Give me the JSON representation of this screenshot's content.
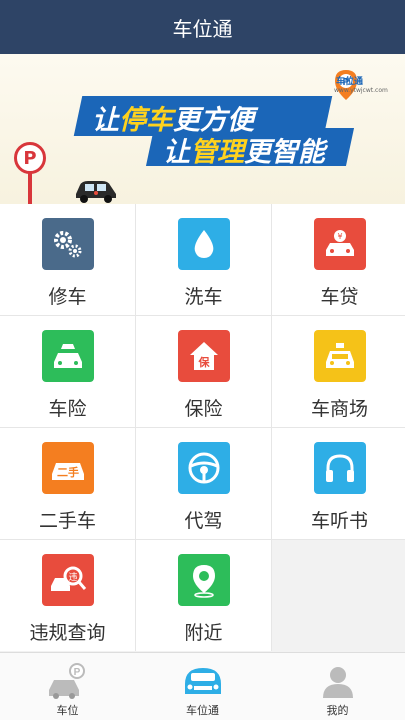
{
  "header": {
    "title": "车位通"
  },
  "banner": {
    "line1_pre": "让",
    "line1_hl": "停车",
    "line1_post": "更方便",
    "line2_pre": "让",
    "line2_hl": "管理",
    "line2_post": "更智能",
    "logo_text": "车位通",
    "logo_url": "www.ytwjcwt.com",
    "parking_letter": "P"
  },
  "services": [
    {
      "label": "修车",
      "icon": "gears-icon",
      "color": "#4a6a8a"
    },
    {
      "label": "洗车",
      "icon": "water-drop-icon",
      "color": "#2eaee6"
    },
    {
      "label": "车贷",
      "icon": "car-loan-icon",
      "color": "#e84c3d"
    },
    {
      "label": "车险",
      "icon": "car-insurance-icon",
      "color": "#2dbd5a"
    },
    {
      "label": "保险",
      "icon": "insurance-house-icon",
      "color": "#e84c3d"
    },
    {
      "label": "车商场",
      "icon": "taxi-icon",
      "color": "#f5c218"
    },
    {
      "label": "二手车",
      "icon": "used-car-icon",
      "color": "#f47e20"
    },
    {
      "label": "代驾",
      "icon": "steering-wheel-icon",
      "color": "#2eaee6"
    },
    {
      "label": "车听书",
      "icon": "headphones-icon",
      "color": "#2eaee6"
    },
    {
      "label": "违规查询",
      "icon": "violation-search-icon",
      "color": "#e84c3d"
    },
    {
      "label": "附近",
      "icon": "location-pin-icon",
      "color": "#2dbd5a"
    }
  ],
  "tabs": [
    {
      "label": "车位",
      "icon": "parking-car-icon",
      "active": false
    },
    {
      "label": "车位通",
      "icon": "car-front-icon",
      "active": true
    },
    {
      "label": "我的",
      "icon": "user-icon",
      "active": false
    }
  ],
  "colors": {
    "header_bg": "#2e4466",
    "banner_blue": "#1b66b8",
    "highlight_yellow": "#ffd21e",
    "active_tab": "#2eaee6"
  }
}
